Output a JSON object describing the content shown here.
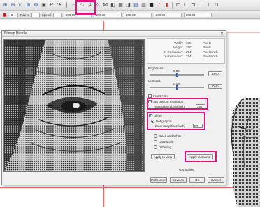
{
  "toolbar1": {
    "icons": [
      "zoom-in-icon",
      "zoom-out-icon",
      "zoom-fit-icon",
      "zoom-page-icon",
      "zoom-select-icon",
      "crop-icon",
      "undo-icon",
      "redo-icon",
      "line-tool-icon",
      "eraser-icon",
      "pen-tool-icon",
      "text-tool-icon",
      "distort-icon",
      "mirror-icon",
      "image-icon",
      "grid-icon",
      "palette-icon",
      "monitor-icon",
      "folder-icon",
      "pencil-icon",
      "paint-icon"
    ]
  },
  "toolbar2": {
    "pos_label": "Power",
    "speed_label": "Speed",
    "ruler_values": [
      "100.00",
      "150.00",
      "200.00",
      "250.00",
      "300.00"
    ]
  },
  "dialog": {
    "title": "Bitmap Handle",
    "close": "✕",
    "info": [
      {
        "key": "Width:",
        "value": "375",
        "unit": "Pixels"
      },
      {
        "key": "Height:",
        "value": "250",
        "unit": "Pixels"
      },
      {
        "key": "X-Resolution:",
        "value": "254",
        "unit": "Pixels/inch"
      },
      {
        "key": "Y-Resolution:",
        "value": "254",
        "unit": "Pixels/inch"
      }
    ],
    "brightness_label": "Brightness:",
    "brightness_value": "0.0%",
    "brightness_fraction": 0.5,
    "contrast_label": "Contrast:",
    "contrast_value": "0.0%",
    "contrast_fraction": 0.5,
    "zero_btn": "Zero",
    "zero_btn2": "Zero",
    "invert_label": "Invert color",
    "resolution_chk_label": "Set custom resolution",
    "resolution_label": "Resolution(pixels/inch)",
    "resolution_value": "254",
    "dither_label": "Dither",
    "netgraphic_label": "Net graphic",
    "frequency_label": "Frequency(lines/inch)",
    "frequency_value": "60",
    "bw_label": "Black and White",
    "grayscale_label": "Gray scale",
    "dithering_label": "Dithering",
    "apply_to_view_btn": "Apply to view",
    "apply_to_source_btn": "Apply to source",
    "get_outline_btn": "Get outline",
    "pullbmp_btn": "PullScreen",
    "save_as_btn": "Save as",
    "ok_btn": "Ok",
    "cancel_btn": "Cancel"
  },
  "colors": {
    "highlight": "#e0157d",
    "guide": "#e26b6b"
  }
}
